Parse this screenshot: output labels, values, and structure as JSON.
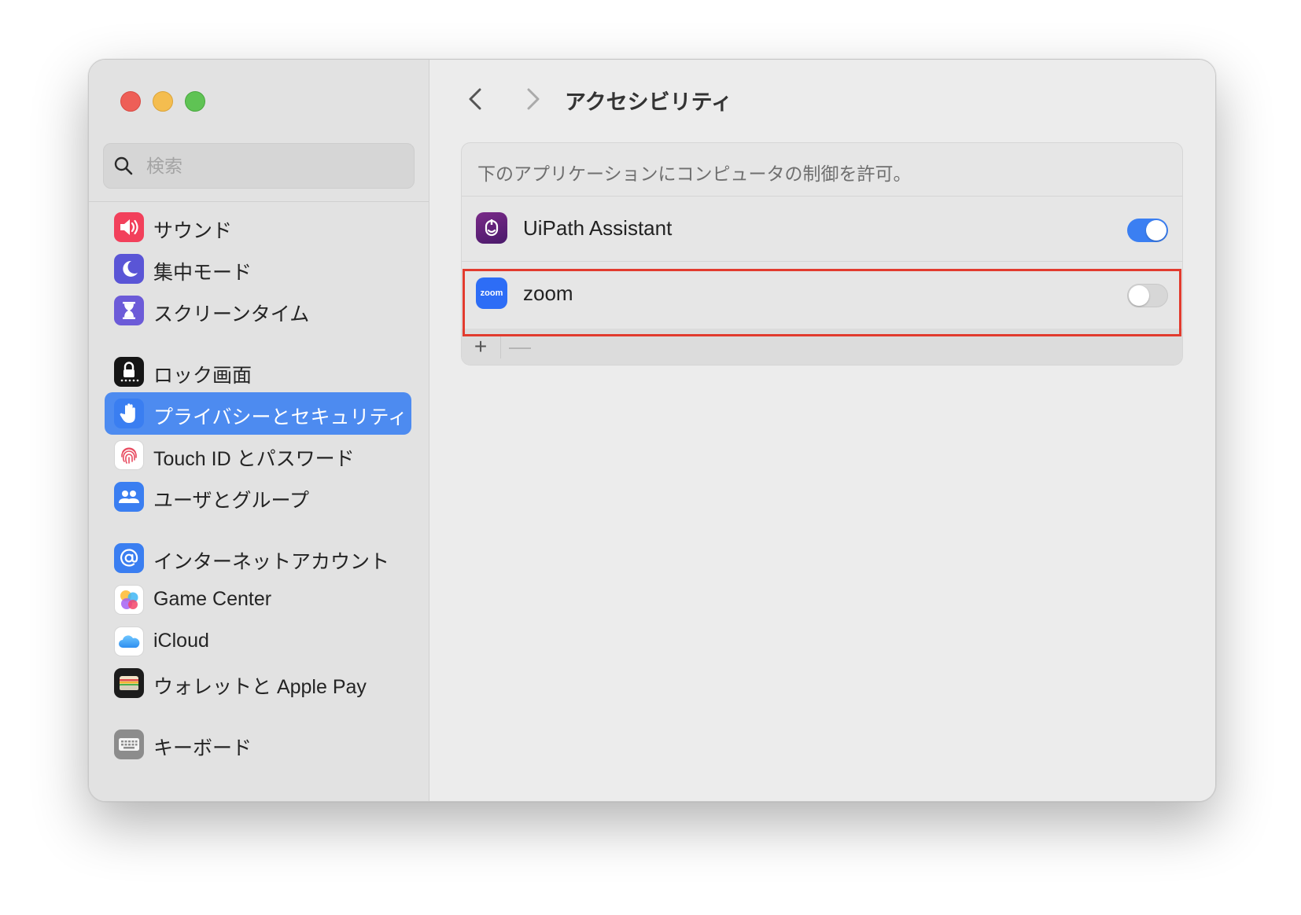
{
  "window": {
    "title": "アクセシビリティ",
    "controls": [
      "close",
      "minimize",
      "zoom"
    ]
  },
  "search": {
    "placeholder": "検索",
    "icon": "search-icon"
  },
  "sidebar": {
    "items": [
      {
        "label": "サウンド",
        "icon": "speaker-icon",
        "color": "#f2405b",
        "selected": false
      },
      {
        "label": "集中モード",
        "icon": "moon-icon",
        "color": "#5a55d6",
        "selected": false
      },
      {
        "label": "スクリーンタイム",
        "icon": "hourglass-icon",
        "color": "#6c5bd8",
        "selected": false
      },
      {
        "label": "ロック画面",
        "icon": "lock-icon",
        "color": "#151515",
        "selected": false
      },
      {
        "label": "プライバシーとセキュリティ",
        "icon": "hand-icon",
        "color": "#3a7ef1",
        "selected": true
      },
      {
        "label": "Touch ID とパスワード",
        "icon": "fingerprint-icon",
        "color": "#ffffff",
        "selected": false
      },
      {
        "label": "ユーザとグループ",
        "icon": "users-icon",
        "color": "#3a7ef1",
        "selected": false
      },
      {
        "label": "インターネットアカウント",
        "icon": "at-icon",
        "color": "#3a7ef1",
        "selected": false
      },
      {
        "label": "Game Center",
        "icon": "game-center-icon",
        "color": "#ffffff",
        "selected": false
      },
      {
        "label": "iCloud",
        "icon": "cloud-icon",
        "color": "#ffffff",
        "selected": false
      },
      {
        "label": "ウォレットと Apple Pay",
        "icon": "wallet-icon",
        "color": "#1c1c1c",
        "selected": false
      },
      {
        "label": "キーボード",
        "icon": "keyboard-icon",
        "color": "#8c8c8c",
        "selected": false
      }
    ]
  },
  "main": {
    "title": "アクセシビリティ",
    "back_icon": "chevron-left-icon",
    "forward_icon": "chevron-right-icon",
    "panel": {
      "header": "下のアプリケーションにコンピュータの制御を許可。",
      "apps": [
        {
          "name": "UiPath Assistant",
          "icon": "uipath-icon",
          "enabled": true,
          "highlighted": true
        },
        {
          "name": "zoom",
          "icon": "zoom-icon",
          "icon_text": "zoom",
          "enabled": false,
          "highlighted": false
        }
      ],
      "footer": {
        "add_label": "+",
        "remove_label": "—",
        "remove_enabled": false
      }
    }
  },
  "colors": {
    "accent": "#3b7ff2",
    "selection": "#4d8bf0",
    "highlight_border": "#e23b2e"
  }
}
